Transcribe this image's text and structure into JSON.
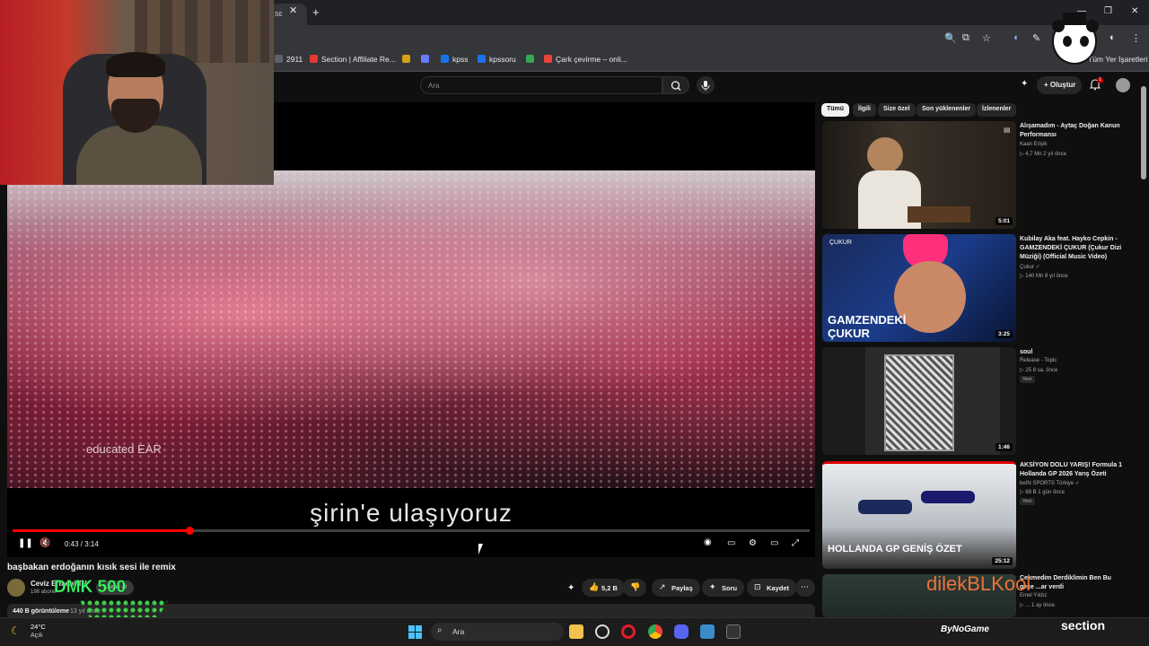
{
  "browser": {
    "tab_title": "sɛ",
    "close_symbol": "✕",
    "new_tab_symbol": "+",
    "bookmarks": [
      {
        "label": "2911",
        "color": "#5f6368"
      },
      {
        "label": "Section | Affiliate Re...",
        "color": "#e53935"
      },
      {
        "label": "",
        "color": "#d4a017"
      },
      {
        "label": "",
        "color": "#6c7aff"
      },
      {
        "label": "kpss",
        "color": "#1a73e8"
      },
      {
        "label": "kpssoru",
        "color": "#1a73e8"
      },
      {
        "label": "",
        "color": "#34a853"
      },
      {
        "label": "Çark çevirme – onli...",
        "color": "#ea4335"
      }
    ],
    "bookmarks_right": "Tüm Yer İşaretleri"
  },
  "youtube": {
    "search_placeholder": "Ara",
    "create_label": "Oluştur",
    "notification_count": "1"
  },
  "player": {
    "subtitle": "şirin'e ulaşıyoruz",
    "watermark": "educated EAR",
    "time_current": "0:43",
    "time_total": "3:14",
    "time_display": "0:43 / 3:14",
    "progress": 0.222
  },
  "video": {
    "title": "başbakan erdoğanın kısık sesi ile remix",
    "channel": "Ceviz Ermeni TV",
    "subscribers": "198 abone",
    "subscribe_label": "Abone ol",
    "likes": "5,2 B",
    "share_label": "Paylaş",
    "ask_label": "Soru",
    "save_label": "Kaydet",
    "views": "440 B görüntüleme",
    "uploaded": "13 yıl önce"
  },
  "chips": [
    {
      "label": "Tümü",
      "active": true
    },
    {
      "label": "İlgili",
      "active": false
    },
    {
      "label": "Size özel",
      "active": false
    },
    {
      "label": "Son yüklenenler",
      "active": false
    },
    {
      "label": "İzlenenler",
      "active": false
    }
  ],
  "recommendations": [
    {
      "title": "Alışamadım - Aytaç Doğan Kanun Performansı",
      "channel": "Kaan Erişik",
      "meta": "▷ 4,7 Mn   2 yıl önce",
      "duration": "5:01",
      "badge": "",
      "thumb_text": ""
    },
    {
      "title": "Kubilay Aka feat. Hayko Cepkin - GAMZENDEKİ ÇUKUR (Çukur Dizi Müziği) (Official Music Video)",
      "channel": "Çukur ✓",
      "meta": "▷ 140 Mn   8 yıl önce",
      "duration": "3:25",
      "badge": "",
      "thumb_text": "GAMZENDEKİ ÇUKUR",
      "thumb_logo": "ÇUKUR"
    },
    {
      "title": "soul",
      "channel": "Release - Topic",
      "meta": "▷ 25   8 sa. önce",
      "duration": "1:46",
      "badge": "Yeni",
      "thumb_text": ""
    },
    {
      "title": "AKSİYON DOLU YARIŞ! Formula 1 Hollanda GP 2026 Yarış Özeti",
      "channel": "beIN SPORTS Türkiye ✓",
      "meta": "▷ 88 B   1 gün önce",
      "duration": "25:12",
      "badge": "Yeni",
      "thumb_text": "HOLLANDA GP GENİŞ ÖZET"
    },
    {
      "title": "Çekmedim Derdiklimin Ben Bu gece ...ar verdi",
      "channel": "Emel Yıldız",
      "meta": "▷ ...   1 ay önce",
      "duration": "",
      "badge": "",
      "thumb_text": ""
    }
  ],
  "overlays": {
    "donation": "DMK 500",
    "dilek": "dilekBLKool"
  },
  "taskbar": {
    "temp": "24°C",
    "condition": "Açık",
    "search": "Ara",
    "bynogame": "ByNoGame",
    "section": "section"
  }
}
